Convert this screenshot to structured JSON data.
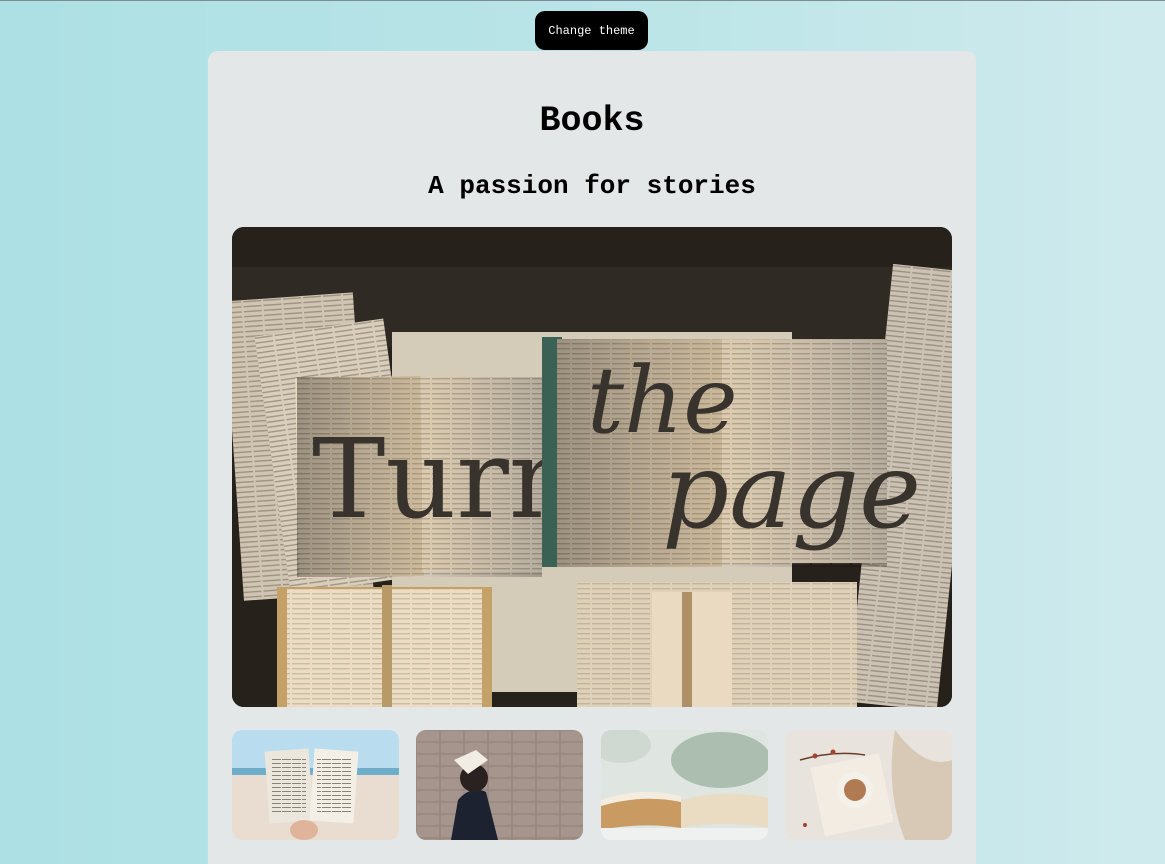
{
  "header": {
    "theme_button_label": "Change theme"
  },
  "main": {
    "title": "Books",
    "subtitle": "A passion for stories",
    "hero_image": {
      "alt_description": "Open books spelling Turn the page",
      "words": [
        "Turn",
        "the",
        "page"
      ]
    },
    "thumbnails": [
      {
        "name": "book-on-beach-image"
      },
      {
        "name": "woman-reading-by-brick-wall-image"
      },
      {
        "name": "open-book-closeup-image"
      },
      {
        "name": "book-with-coffee-cup-image"
      }
    ]
  },
  "colors": {
    "background_start": "#ace0e4",
    "background_end": "#cfeaed",
    "card": "#e4e7e7",
    "button": "#000000",
    "button_text": "#ffffff"
  }
}
